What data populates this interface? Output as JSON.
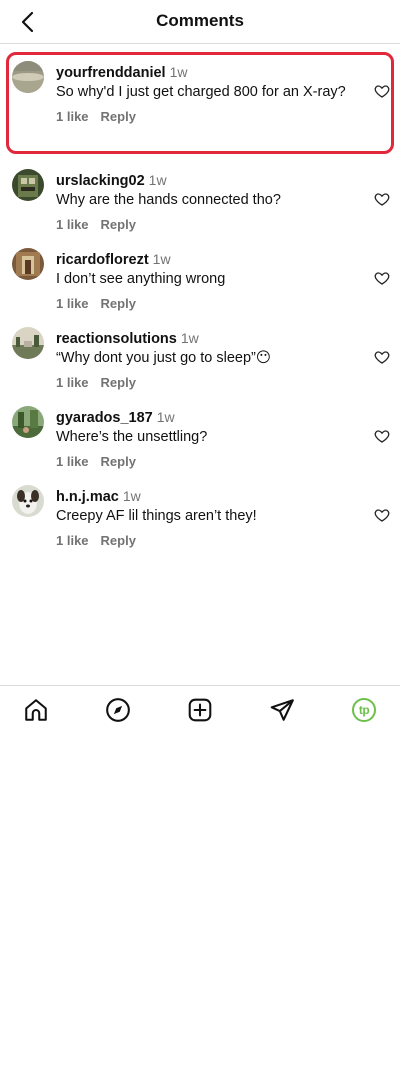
{
  "header": {
    "title": "Comments"
  },
  "comments": [
    {
      "username": "yourfrenddaniel",
      "time": "1w",
      "text": "So why'd I just get charged 800 for an X-ray?",
      "likes": "1 like",
      "reply": "Reply",
      "highlighted": true
    },
    {
      "username": "urslacking02",
      "time": "1w",
      "text": "Why are the hands connected tho?",
      "likes": "1 like",
      "reply": "Reply"
    },
    {
      "username": "ricardoflorezt",
      "time": "1w",
      "text": "I don’t see anything wrong",
      "likes": "1 like",
      "reply": "Reply"
    },
    {
      "username": "reactionsolutions",
      "time": "1w",
      "text": "“Why dont you just go to sleep”😶",
      "likes": "1 like",
      "reply": "Reply"
    },
    {
      "username": "gyarados_187",
      "time": "1w",
      "text": "Where’s the unsettling?",
      "likes": "1 like",
      "reply": "Reply"
    },
    {
      "username": "h.n.j.mac",
      "time": "1w",
      "text": "Creepy AF lil things aren’t they!",
      "likes": "1 like",
      "reply": "Reply"
    }
  ],
  "nav": {
    "profile_initials": "tp",
    "profile_color": "#6cc04a"
  },
  "colors": {
    "highlight": "#e0283a",
    "muted": "#737373"
  }
}
